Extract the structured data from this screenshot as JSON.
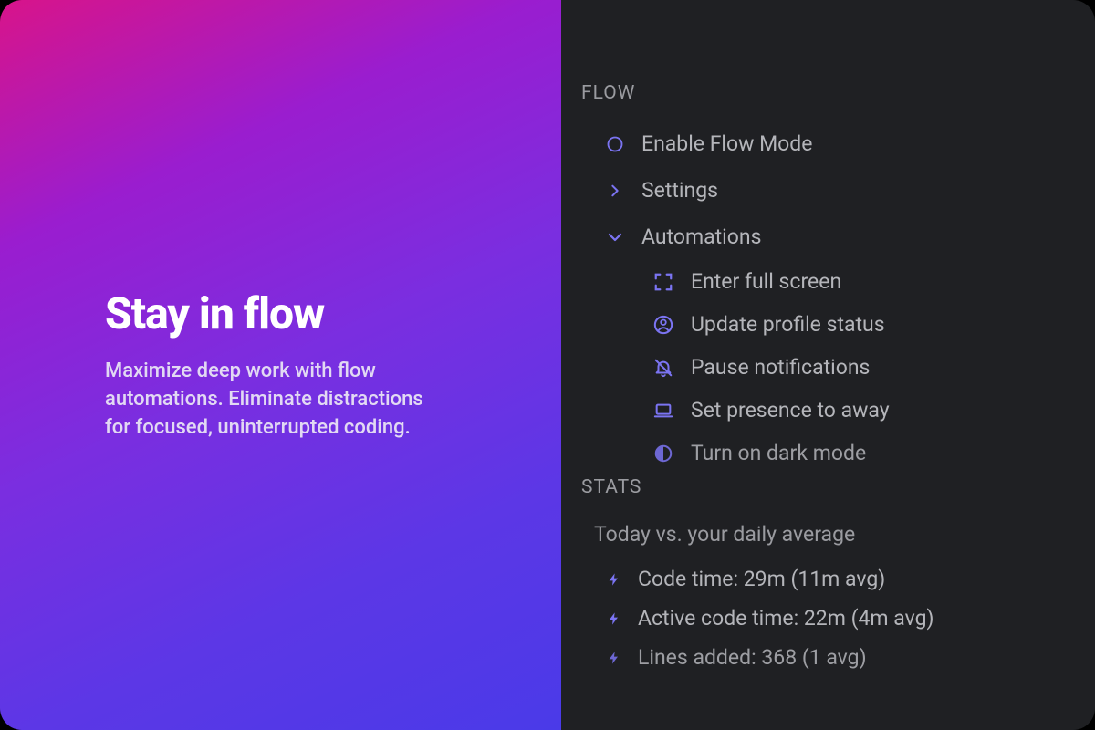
{
  "hero": {
    "title": "Stay in flow",
    "description": "Maximize deep work with flow automations. Eliminate distractions for focused, uninterrupted coding."
  },
  "flow": {
    "header": "FLOW",
    "enable_label": "Enable Flow Mode",
    "settings_label": "Settings",
    "automations_label": "Automations",
    "automations": [
      {
        "icon": "fullscreen-icon",
        "label": "Enter full screen"
      },
      {
        "icon": "profile-icon",
        "label": "Update profile status"
      },
      {
        "icon": "bell-off-icon",
        "label": "Pause notifications"
      },
      {
        "icon": "laptop-icon",
        "label": "Set presence to away"
      },
      {
        "icon": "moon-icon",
        "label": "Turn on dark mode"
      }
    ]
  },
  "stats": {
    "header": "STATS",
    "subtitle": "Today vs. your daily average",
    "items": [
      "Code time: 29m (11m avg)",
      "Active code time: 22m (4m avg)",
      "Lines added: 368 (1 avg)"
    ]
  },
  "colors": {
    "accent": "#7b74f2",
    "panel_bg": "#1f2023"
  }
}
